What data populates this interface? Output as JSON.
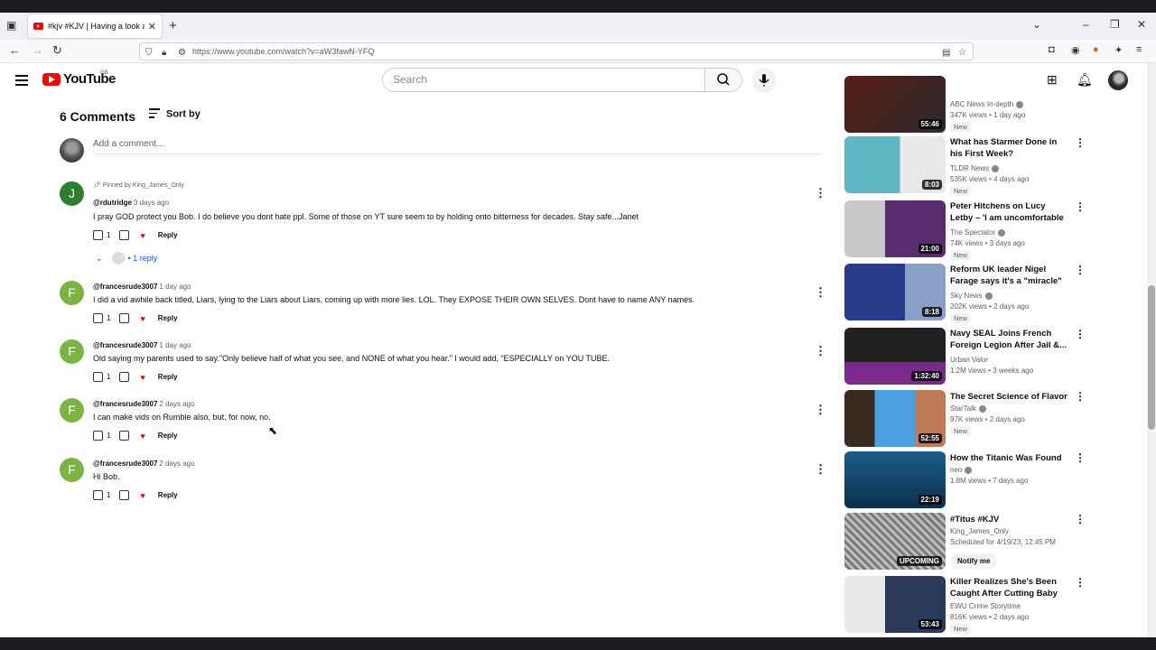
{
  "browser": {
    "tab_title": "#kjv #KJV | Having a look at stu",
    "url": "https://www.youtube.com/watch?v=aW3fawN-YFQ"
  },
  "header": {
    "logo_text": "YouTube",
    "region": "GB",
    "search_placeholder": "Search"
  },
  "comments": {
    "count_label": "6 Comments",
    "sort_label": "Sort by",
    "add_placeholder": "Add a comment...",
    "items": [
      {
        "avatar": "J",
        "color": "#2e7d32",
        "pinned": "Pinned by King_James_Only",
        "author": "@rdutridge",
        "time": "3 days ago",
        "text": "I pray GOD protect you Bob. I do believe you dont hate ppl. Some of those on YT sure seem to  by holding onto bitterness for decades. Stay safe...Janet",
        "likes": "1",
        "reply": "Reply",
        "replies": "• 1 reply"
      },
      {
        "avatar": "F",
        "color": "#7cb342",
        "author": "@francesrude3007",
        "time": "1 day ago",
        "text": "I did  a vid awhile back titled, Liars, lying to the Liars about Liars, coming up with more lies. LOL. They EXPOSE THEIR OWN SELVES. Dont have to name ANY names.",
        "likes": "1",
        "reply": "Reply"
      },
      {
        "avatar": "F",
        "color": "#7cb342",
        "author": "@francesrude3007",
        "time": "1 day ago",
        "text": "Old saying my parents used to say.\"Only believe half of what you see, and NONE of what you hear.\" I would add, \"ESPECIALLY on YOU TUBE.",
        "likes": "1",
        "reply": "Reply"
      },
      {
        "avatar": "F",
        "color": "#7cb342",
        "author": "@francesrude3007",
        "time": "2 days ago",
        "text": "I can make vids on Rumble also, but, for now, no.",
        "likes": "1",
        "reply": "Reply"
      },
      {
        "avatar": "F",
        "color": "#7cb342",
        "author": "@francesrude3007",
        "time": "2 days ago",
        "text": "Hi Bob.",
        "likes": "1",
        "reply": "Reply"
      }
    ]
  },
  "sidebar": [
    {
      "title": "",
      "channel": "ABC News In-depth",
      "meta": "347K views  •  1 day ago",
      "new": "New",
      "duration": "55:46"
    },
    {
      "title": "What has Starmer Done in his First Week?",
      "channel": "TLDR News",
      "meta": "535K views  •  4 days ago",
      "new": "New",
      "duration": "8:03"
    },
    {
      "title": "Peter Hitchens on Lucy Letby – 'I am uncomfortable about this...",
      "channel": "The Spectator",
      "meta": "74K views  •  3 days ago",
      "new": "New",
      "duration": "21:00"
    },
    {
      "title": "Reform UK leader Nigel Farage says it's a \"miracle\" that Donal...",
      "channel": "Sky News",
      "meta": "202K views  •  2 days ago",
      "new": "New",
      "duration": "8:18"
    },
    {
      "title": "Navy SEAL Joins French Foreign Legion After Jail &...",
      "channel": "Urban Valor",
      "meta": "1.2M views  •  3 weeks ago",
      "new": "",
      "duration": "1:32:40"
    },
    {
      "title": "The Secret Science of Flavor",
      "channel": "StarTalk",
      "meta": "97K views  •  2 days ago",
      "new": "New",
      "duration": "52:55"
    },
    {
      "title": "How the Titanic Was Found",
      "channel": "neo",
      "meta": "1.8M views  •  7 days ago",
      "new": "",
      "duration": "22:19"
    },
    {
      "title": "#Titus #KJV",
      "channel": "King_James_Only",
      "meta": "Scheduled for 4/19/23, 12:45 PM",
      "new": "",
      "duration": "UPCOMING",
      "notify": "Notify me"
    },
    {
      "title": "Killer Realizes She's Been Caught After Cutting Baby Out...",
      "channel": "EWU Crime Storytime",
      "meta": "816K views  •  2 days ago",
      "new": "New",
      "duration": "53:43"
    }
  ]
}
